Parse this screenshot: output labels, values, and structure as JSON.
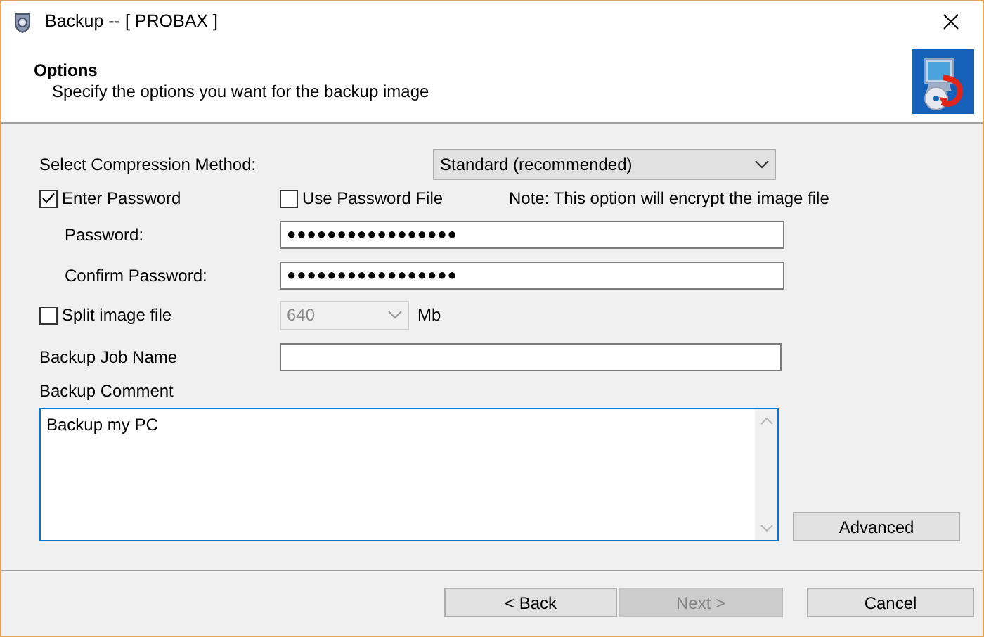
{
  "window": {
    "title": "Backup -- [ PROBAX ]"
  },
  "header": {
    "title": "Options",
    "subtitle": "Specify the options you want for the backup image"
  },
  "compression": {
    "label": "Select Compression Method:",
    "value": "Standard (recommended)"
  },
  "enter_password": {
    "label": "Enter Password",
    "checked": true
  },
  "use_password_file": {
    "label": "Use Password File",
    "checked": false
  },
  "note": "Note: This option will encrypt the image file",
  "password": {
    "label": "Password:",
    "value": "●●●●●●●●●●●●●●●●●"
  },
  "confirm_password": {
    "label": "Confirm Password:",
    "value": "●●●●●●●●●●●●●●●●●"
  },
  "split": {
    "label": "Split image file",
    "checked": false,
    "size": {
      "value": "640",
      "disabled": true
    },
    "unit": "Mb"
  },
  "job_name": {
    "label": "Backup Job Name"
  },
  "comment": {
    "label": "Backup Comment",
    "value": "Backup my PC"
  },
  "advanced_button": {
    "label": "Advanced"
  },
  "nav_buttons": [
    {
      "label": "< Back",
      "disabled": false
    },
    {
      "label": "Next >",
      "disabled": true
    },
    {
      "label": "Cancel",
      "disabled": false
    }
  ]
}
